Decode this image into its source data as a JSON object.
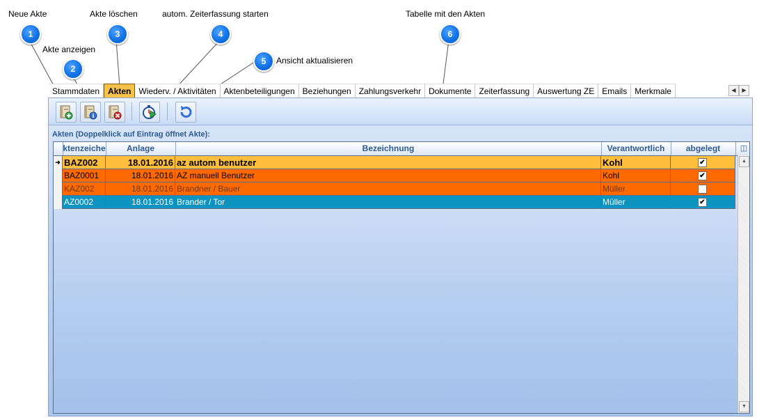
{
  "callouts": [
    {
      "num": "1",
      "label": "Neue Akte"
    },
    {
      "num": "2",
      "label": "Akte anzeigen"
    },
    {
      "num": "3",
      "label": "Akte löschen"
    },
    {
      "num": "4",
      "label": "autom. Zeiterfassung starten"
    },
    {
      "num": "5",
      "label": "Ansicht aktualisieren"
    },
    {
      "num": "6",
      "label": "Tabelle mit den Akten"
    }
  ],
  "tabs": [
    "Stammdaten",
    "Akten",
    "Wiederv. / Aktivitäten",
    "Aktenbeteiligungen",
    "Beziehungen",
    "Zahlungsverkehr",
    "Dokumente",
    "Zeiterfassung",
    "Auswertung ZE",
    "Emails",
    "Merkmale"
  ],
  "active_tab": "Akten",
  "tab_scroll": {
    "left": "◀",
    "right": "▶"
  },
  "list_caption": "Akten (Doppelklick auf Eintrag öffnet Akte):",
  "columns": [
    "ktenzeiche",
    "Anlage",
    "Bezeichnung",
    "Verantwortlich",
    "abgelegt"
  ],
  "rows": [
    {
      "az": "BAZ002",
      "anlage": "18.01.2016",
      "bez": "az autom benutzer",
      "verantw": "Kohl",
      "abgelegt": true,
      "current": true,
      "bg": "#ffbe3c",
      "fg": "#000000"
    },
    {
      "az": "BAZ0001",
      "anlage": "18.01.2016",
      "bez": "AZ manuell Benutzer",
      "verantw": "Kohl",
      "abgelegt": true,
      "current": false,
      "bg": "#ff6a00",
      "fg": "#000000"
    },
    {
      "az": "KAZ002",
      "anlage": "18.01.2016",
      "bez": "Brandner / Bauer",
      "verantw": "Müller",
      "abgelegt": false,
      "current": false,
      "bg": "#ff6a00",
      "fg": "#6b3a18"
    },
    {
      "az": "AZ0002",
      "anlage": "18.01.2016",
      "bez": "Brander / Tor",
      "verantw": "Müller",
      "abgelegt": true,
      "current": false,
      "bg": "#0d93c0",
      "fg": "#ffffff"
    }
  ],
  "colors": {
    "accent": "#1273e6",
    "active_tab": "#f7c14a",
    "header_text": "#2f5a93"
  }
}
